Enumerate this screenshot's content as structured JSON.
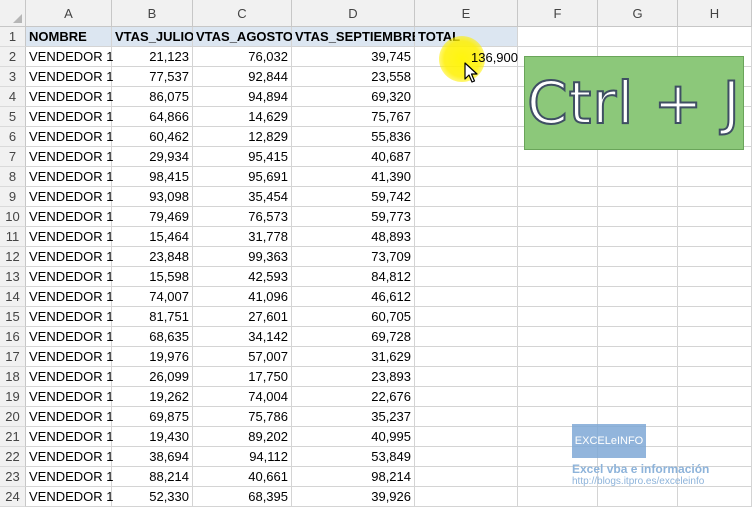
{
  "columns": [
    "A",
    "B",
    "C",
    "D",
    "E",
    "F",
    "G",
    "H"
  ],
  "header_row": {
    "number": "1",
    "cells": [
      "NOMBRE",
      "VTAS_JULIO",
      "VTAS_AGOSTO",
      "VTAS_SEPTIEMBRE",
      "TOTAL"
    ]
  },
  "rows": [
    {
      "n": "2",
      "a": "VENDEDOR 1",
      "b": "21,123",
      "c": "76,032",
      "d": "39,745"
    },
    {
      "n": "3",
      "a": "VENDEDOR 1",
      "b": "77,537",
      "c": "92,844",
      "d": "23,558"
    },
    {
      "n": "4",
      "a": "VENDEDOR 1",
      "b": "86,075",
      "c": "94,894",
      "d": "69,320"
    },
    {
      "n": "5",
      "a": "VENDEDOR 1",
      "b": "64,866",
      "c": "14,629",
      "d": "75,767"
    },
    {
      "n": "6",
      "a": "VENDEDOR 1",
      "b": "60,462",
      "c": "12,829",
      "d": "55,836"
    },
    {
      "n": "7",
      "a": "VENDEDOR 1",
      "b": "29,934",
      "c": "95,415",
      "d": "40,687"
    },
    {
      "n": "8",
      "a": "VENDEDOR 1",
      "b": "98,415",
      "c": "95,691",
      "d": "41,390"
    },
    {
      "n": "9",
      "a": "VENDEDOR 1",
      "b": "93,098",
      "c": "35,454",
      "d": "59,742"
    },
    {
      "n": "10",
      "a": "VENDEDOR 1",
      "b": "79,469",
      "c": "76,573",
      "d": "59,773"
    },
    {
      "n": "11",
      "a": "VENDEDOR 1",
      "b": "15,464",
      "c": "31,778",
      "d": "48,893"
    },
    {
      "n": "12",
      "a": "VENDEDOR 1",
      "b": "23,848",
      "c": "99,363",
      "d": "73,709"
    },
    {
      "n": "13",
      "a": "VENDEDOR 1",
      "b": "15,598",
      "c": "42,593",
      "d": "84,812"
    },
    {
      "n": "14",
      "a": "VENDEDOR 1",
      "b": "74,007",
      "c": "41,096",
      "d": "46,612"
    },
    {
      "n": "15",
      "a": "VENDEDOR 1",
      "b": "81,751",
      "c": "27,601",
      "d": "60,705"
    },
    {
      "n": "16",
      "a": "VENDEDOR 1",
      "b": "68,635",
      "c": "34,142",
      "d": "69,728"
    },
    {
      "n": "17",
      "a": "VENDEDOR 1",
      "b": "19,976",
      "c": "57,007",
      "d": "31,629"
    },
    {
      "n": "18",
      "a": "VENDEDOR 1",
      "b": "26,099",
      "c": "17,750",
      "d": "23,893"
    },
    {
      "n": "19",
      "a": "VENDEDOR 1",
      "b": "19,262",
      "c": "74,004",
      "d": "22,676"
    },
    {
      "n": "20",
      "a": "VENDEDOR 1",
      "b": "69,875",
      "c": "75,786",
      "d": "35,237"
    },
    {
      "n": "21",
      "a": "VENDEDOR 1",
      "b": "19,430",
      "c": "89,202",
      "d": "40,995"
    },
    {
      "n": "22",
      "a": "VENDEDOR 1",
      "b": "38,694",
      "c": "94,112",
      "d": "53,849"
    },
    {
      "n": "23",
      "a": "VENDEDOR 1",
      "b": "88,214",
      "c": "40,661",
      "d": "98,214"
    },
    {
      "n": "24",
      "a": "VENDEDOR 1",
      "b": "52,330",
      "c": "68,395",
      "d": "39,926"
    }
  ],
  "total_e2": "136,900",
  "shortcut_label": "Ctrl + J",
  "watermark": {
    "box_text": "EXCELeINFO",
    "line1": "Excel vba e información",
    "line2": "http://blogs.itpro.es/exceleinfo"
  },
  "icons": {
    "cursor": "mouse-pointer-icon",
    "select_all": "select-all-triangle-icon"
  },
  "colors": {
    "header_row_fill": "#dce6f1",
    "highlight": "#fff200",
    "shortcut_box": "#8cc87a",
    "watermark": "#8db3da"
  }
}
